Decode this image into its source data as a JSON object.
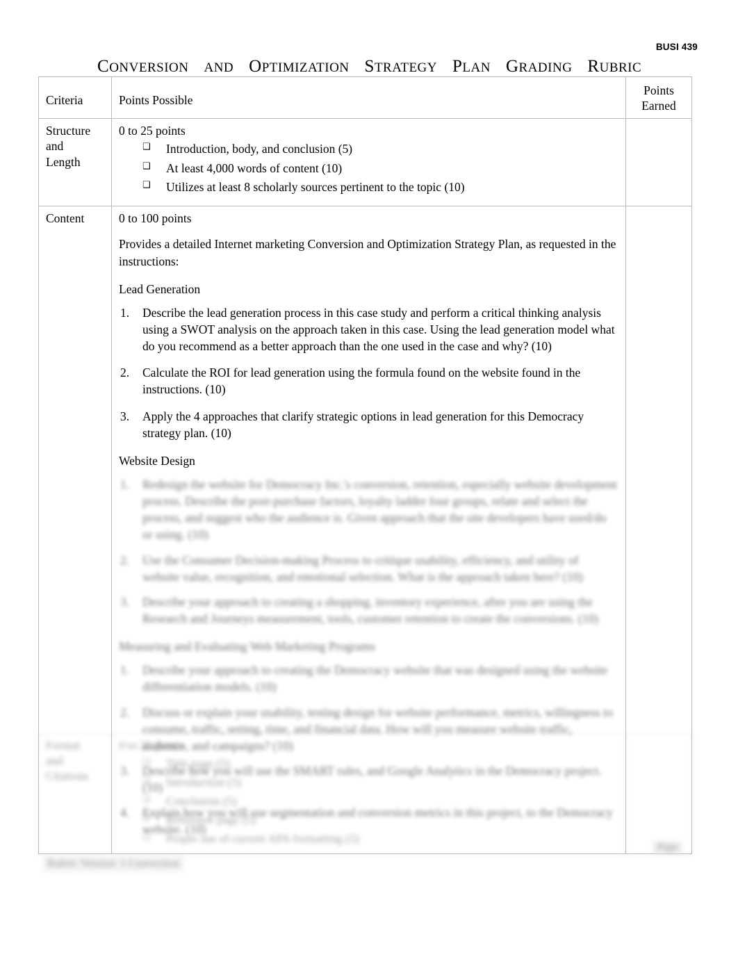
{
  "document": {
    "header_course": "BUSI 439",
    "title_parts": [
      {
        "cap": "C",
        "rest": "ONVERSION"
      },
      {
        "cap": "",
        "rest": "AND"
      },
      {
        "cap": "O",
        "rest": "PTIMIZATION"
      },
      {
        "cap": "S",
        "rest": "TRATEGY"
      },
      {
        "cap": "P",
        "rest": "LAN"
      },
      {
        "cap": "G",
        "rest": "RADING"
      },
      {
        "cap": "R",
        "rest": "UBRIC"
      }
    ],
    "title_plain": "Conversion and Optimization Strategy Plan Grading Rubric"
  },
  "table": {
    "headers": {
      "criteria": "Criteria",
      "points_possible": "Points Possible",
      "points_earned_line1": "Points",
      "points_earned_line2": "Earned"
    },
    "rows": [
      {
        "criteria": "Structure and Length",
        "criteria_lines": [
          "Structure",
          "and",
          "Length"
        ],
        "points_line": "0 to 25 points",
        "bullets": [
          "Introduction, body, and conclusion (5)",
          "At least 4,000 words of content (10)",
          "Utilizes at least 8 scholarly sources pertinent to the topic (10)"
        ],
        "earned": ""
      },
      {
        "criteria": "Content",
        "points_line": "0 to 100 points",
        "intro": "Provides a detailed Internet marketing Conversion and Optimization Strategy Plan, as requested in the instructions:",
        "section_1_head": "Lead Generation",
        "section_1_items": [
          "Describe the lead generation process in this case study and perform a critical thinking analysis using a SWOT analysis on the approach taken in this case. Using the lead generation model what do you recommend as a better approach than the one used in the case and why? (10)",
          "Calculate the ROI for lead generation using the formula found on the website found in the instructions. (10)",
          "Apply the 4 approaches that clarify strategic options in lead generation for this Democracy strategy plan. (10)"
        ],
        "section_2_head": "Website Design",
        "section_2_items": [
          "Redesign the website for Democracy Inc.'s conversion, retention, especially website development process. Describe the post-purchase factors, loyalty ladder four groups, relate and select the process, and suggest who the audience is. Given approach that the site developers have used/do or using. (10)",
          "Use the Consumer Decision-making Process to critique usability, efficiency, and utility of website value, recognition, and emotional selection. What is the approach taken here? (10)",
          "Describe your approach to creating a shopping, inventory experience, after you are using the Research and Journeys measurement, tools, customer retention to create the conversions. (10)"
        ],
        "section_3_head": "Measuring and Evaluating Web Marketing Programs",
        "section_3_items": [
          "Describe your approach to creating the Democracy website that was designed using the website differentiation models. (10)",
          "Discuss or explain your usability, testing design for website performance, metrics, willingness to consume, traffic, setting, time, and financial data. How will you measure website traffic, audience, and campaigns? (10)",
          "Describe how you will use the SMART rules, and Google Analytics in the Democracy project. (10)",
          "Explain how you will use segmentation and conversion metrics in this project, to the Democracy website. (10)"
        ],
        "earned": ""
      },
      {
        "criteria": "Format and Citations",
        "criteria_lines": [
          "Format",
          "and",
          "Citations"
        ],
        "points_line": "0 to 25 points",
        "bullets": [
          "Title page (5)",
          "Introduction (5)",
          "Conclusion (5)",
          "Reference page (5)",
          "Proper use of current APA formatting (5)"
        ],
        "earned": ""
      }
    ]
  },
  "footer": {
    "note": "Rubric Version: 1 Conversion",
    "page_label": "Page"
  }
}
